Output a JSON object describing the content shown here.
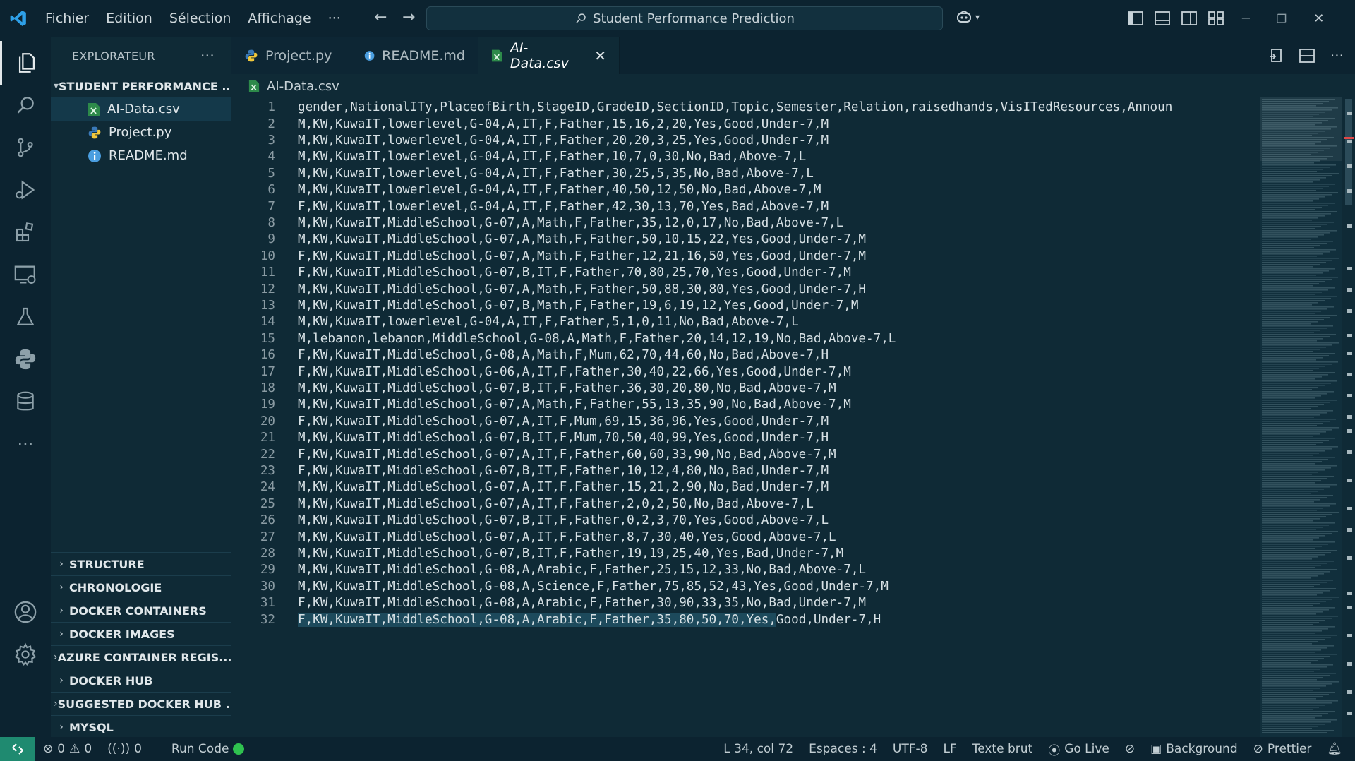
{
  "titlebar": {
    "menu": [
      "Fichier",
      "Edition",
      "Sélection",
      "Affichage",
      "···"
    ],
    "search_text": "Student Performance Prediction"
  },
  "sidebar": {
    "header": "EXPLORATEUR",
    "more": "···",
    "project": "STUDENT PERFORMANCE ...",
    "files": [
      {
        "name": "AI-Data.csv",
        "icon": "csv-file-icon"
      },
      {
        "name": "Project.py",
        "icon": "python-file-icon"
      },
      {
        "name": "README.md",
        "icon": "info-file-icon"
      }
    ],
    "sections": [
      "STRUCTURE",
      "CHRONOLOGIE",
      "DOCKER CONTAINERS",
      "DOCKER IMAGES",
      "AZURE CONTAINER REGIS...",
      "DOCKER HUB",
      "SUGGESTED DOCKER HUB ...",
      "MYSQL"
    ]
  },
  "tabs": [
    {
      "label": "Project.py",
      "icon": "python-file-icon",
      "active": false
    },
    {
      "label": "README.md",
      "icon": "info-file-icon",
      "active": false
    },
    {
      "label": "AI-Data.csv",
      "icon": "csv-file-icon",
      "active": true,
      "close": "✕"
    }
  ],
  "breadcrumb": "AI-Data.csv",
  "editor": {
    "lines": [
      {
        "n": "1",
        "text": "gender,NationalITy,PlaceofBirth,StageID,GradeID,SectionID,Topic,Semester,Relation,raisedhands,VisITedResources,Announ"
      },
      {
        "n": "2",
        "text": "M,KW,KuwaIT,lowerlevel,G-04,A,IT,F,Father,15,16,2,20,Yes,Good,Under-7,M"
      },
      {
        "n": "3",
        "text": "M,KW,KuwaIT,lowerlevel,G-04,A,IT,F,Father,20,20,3,25,Yes,Good,Under-7,M"
      },
      {
        "n": "4",
        "text": "M,KW,KuwaIT,lowerlevel,G-04,A,IT,F,Father,10,7,0,30,No,Bad,Above-7,L"
      },
      {
        "n": "5",
        "text": "M,KW,KuwaIT,lowerlevel,G-04,A,IT,F,Father,30,25,5,35,No,Bad,Above-7,L"
      },
      {
        "n": "6",
        "text": "M,KW,KuwaIT,lowerlevel,G-04,A,IT,F,Father,40,50,12,50,No,Bad,Above-7,M"
      },
      {
        "n": "7",
        "text": "F,KW,KuwaIT,lowerlevel,G-04,A,IT,F,Father,42,30,13,70,Yes,Bad,Above-7,M"
      },
      {
        "n": "8",
        "text": "M,KW,KuwaIT,MiddleSchool,G-07,A,Math,F,Father,35,12,0,17,No,Bad,Above-7,L"
      },
      {
        "n": "9",
        "text": "M,KW,KuwaIT,MiddleSchool,G-07,A,Math,F,Father,50,10,15,22,Yes,Good,Under-7,M"
      },
      {
        "n": "10",
        "text": "F,KW,KuwaIT,MiddleSchool,G-07,A,Math,F,Father,12,21,16,50,Yes,Good,Under-7,M"
      },
      {
        "n": "11",
        "text": "F,KW,KuwaIT,MiddleSchool,G-07,B,IT,F,Father,70,80,25,70,Yes,Good,Under-7,M"
      },
      {
        "n": "12",
        "text": "M,KW,KuwaIT,MiddleSchool,G-07,A,Math,F,Father,50,88,30,80,Yes,Good,Under-7,H"
      },
      {
        "n": "13",
        "text": "M,KW,KuwaIT,MiddleSchool,G-07,B,Math,F,Father,19,6,19,12,Yes,Good,Under-7,M"
      },
      {
        "n": "14",
        "text": "M,KW,KuwaIT,lowerlevel,G-04,A,IT,F,Father,5,1,0,11,No,Bad,Above-7,L"
      },
      {
        "n": "15",
        "text": "M,lebanon,lebanon,MiddleSchool,G-08,A,Math,F,Father,20,14,12,19,No,Bad,Above-7,L"
      },
      {
        "n": "16",
        "text": "F,KW,KuwaIT,MiddleSchool,G-08,A,Math,F,Mum,62,70,44,60,No,Bad,Above-7,H"
      },
      {
        "n": "17",
        "text": "F,KW,KuwaIT,MiddleSchool,G-06,A,IT,F,Father,30,40,22,66,Yes,Good,Under-7,M"
      },
      {
        "n": "18",
        "text": "M,KW,KuwaIT,MiddleSchool,G-07,B,IT,F,Father,36,30,20,80,No,Bad,Above-7,M"
      },
      {
        "n": "19",
        "text": "M,KW,KuwaIT,MiddleSchool,G-07,A,Math,F,Father,55,13,35,90,No,Bad,Above-7,M"
      },
      {
        "n": "20",
        "text": "F,KW,KuwaIT,MiddleSchool,G-07,A,IT,F,Mum,69,15,36,96,Yes,Good,Under-7,M"
      },
      {
        "n": "21",
        "text": "M,KW,KuwaIT,MiddleSchool,G-07,B,IT,F,Mum,70,50,40,99,Yes,Good,Under-7,H"
      },
      {
        "n": "22",
        "text": "F,KW,KuwaIT,MiddleSchool,G-07,A,IT,F,Father,60,60,33,90,No,Bad,Above-7,M"
      },
      {
        "n": "23",
        "text": "F,KW,KuwaIT,MiddleSchool,G-07,B,IT,F,Father,10,12,4,80,No,Bad,Under-7,M"
      },
      {
        "n": "24",
        "text": "M,KW,KuwaIT,MiddleSchool,G-07,A,IT,F,Father,15,21,2,90,No,Bad,Under-7,M"
      },
      {
        "n": "25",
        "text": "M,KW,KuwaIT,MiddleSchool,G-07,A,IT,F,Father,2,0,2,50,No,Bad,Above-7,L"
      },
      {
        "n": "26",
        "text": "M,KW,KuwaIT,MiddleSchool,G-07,B,IT,F,Father,0,2,3,70,Yes,Good,Above-7,L"
      },
      {
        "n": "27",
        "text": "M,KW,KuwaIT,MiddleSchool,G-07,A,IT,F,Father,8,7,30,40,Yes,Good,Above-7,L"
      },
      {
        "n": "28",
        "text": "M,KW,KuwaIT,MiddleSchool,G-07,B,IT,F,Father,19,19,25,40,Yes,Bad,Under-7,M"
      },
      {
        "n": "29",
        "text": "M,KW,KuwaIT,MiddleSchool,G-08,A,Arabic,F,Father,25,15,12,33,No,Bad,Above-7,L"
      },
      {
        "n": "30",
        "text": "M,KW,KuwaIT,MiddleSchool,G-08,A,Science,F,Father,75,85,52,43,Yes,Good,Under-7,M"
      },
      {
        "n": "31",
        "text": "F,KW,KuwaIT,MiddleSchool,G-08,A,Arabic,F,Father,30,90,33,35,No,Bad,Under-7,M"
      },
      {
        "n": "32",
        "text": "F,KW,KuwaIT,MiddleSchool,G-08,A,Arabic,F,Father,35,80,50,70,Yes,Good,Under-7,H",
        "highlight_prefix": "F,KW,KuwaIT,MiddleSchool,G-08,A,Arabic,F,Father,35,80,50,70,Yes,",
        "highlight_rest": "Good,Under-7,H"
      }
    ]
  },
  "statusbar": {
    "errors": "0",
    "warnings": "0",
    "ports": "0",
    "run_code": "Run Code",
    "position": "L 34, col 72",
    "spaces": "Espaces : 4",
    "encoding": "UTF-8",
    "eol": "LF",
    "language": "Texte brut",
    "go_live": "Go Live",
    "background": "Background",
    "prettier": "Prettier"
  },
  "colors": {
    "accent": "#1f8a70",
    "run_dot": "#2fc24f",
    "selection": "#1d4a5c"
  }
}
